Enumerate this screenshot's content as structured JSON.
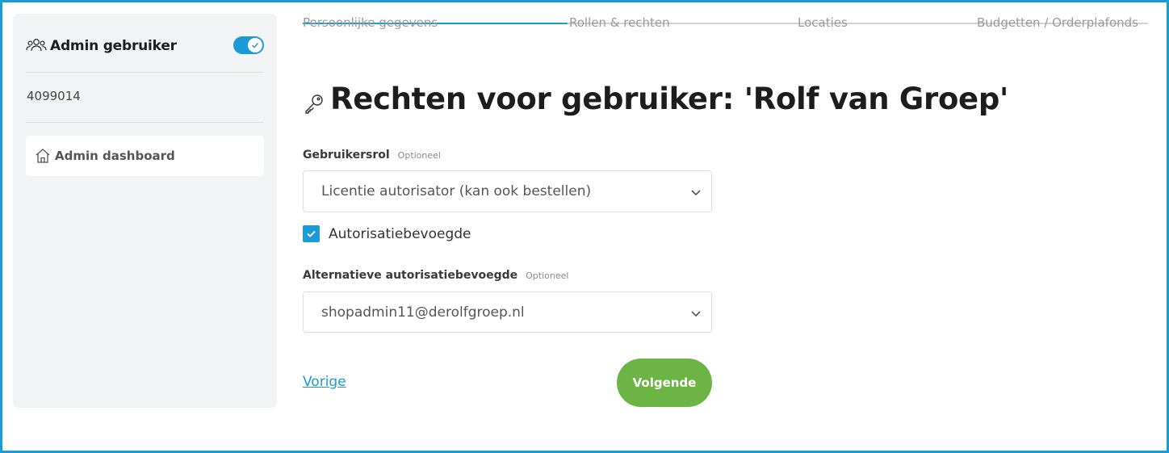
{
  "sidebar": {
    "title": "Admin gebruiker",
    "user_id": "4099014",
    "nav_items": [
      {
        "label": "Admin dashboard",
        "icon": "home-icon"
      }
    ],
    "toggle_on": true
  },
  "steps": [
    {
      "label": "Persoonlijke gegevens",
      "state": "completed"
    },
    {
      "label": "Rollen & rechten",
      "state": "active"
    },
    {
      "label": "Locaties",
      "state": "upcoming"
    },
    {
      "label": "Budgetten / Orderplafonds",
      "state": "upcoming"
    }
  ],
  "page": {
    "title": "Rechten voor gebruiker: 'Rolf van Groep'"
  },
  "form": {
    "role": {
      "label": "Gebruikersrol",
      "optional": "Optioneel",
      "value": "Licentie autorisator (kan ook bestellen)"
    },
    "authorized": {
      "label": "Autorisatiebevoegde",
      "checked": true
    },
    "alt_authorized": {
      "label": "Alternatieve autorisatiebevoegde",
      "optional": "Optioneel",
      "value": "shopadmin11@derolfgroep.nl"
    }
  },
  "actions": {
    "prev_label": "Vorige",
    "next_label": "Volgende"
  },
  "colors": {
    "accent": "#1a9bd7",
    "primary_button": "#6cb444",
    "sidebar_bg": "#f2f3f5"
  }
}
